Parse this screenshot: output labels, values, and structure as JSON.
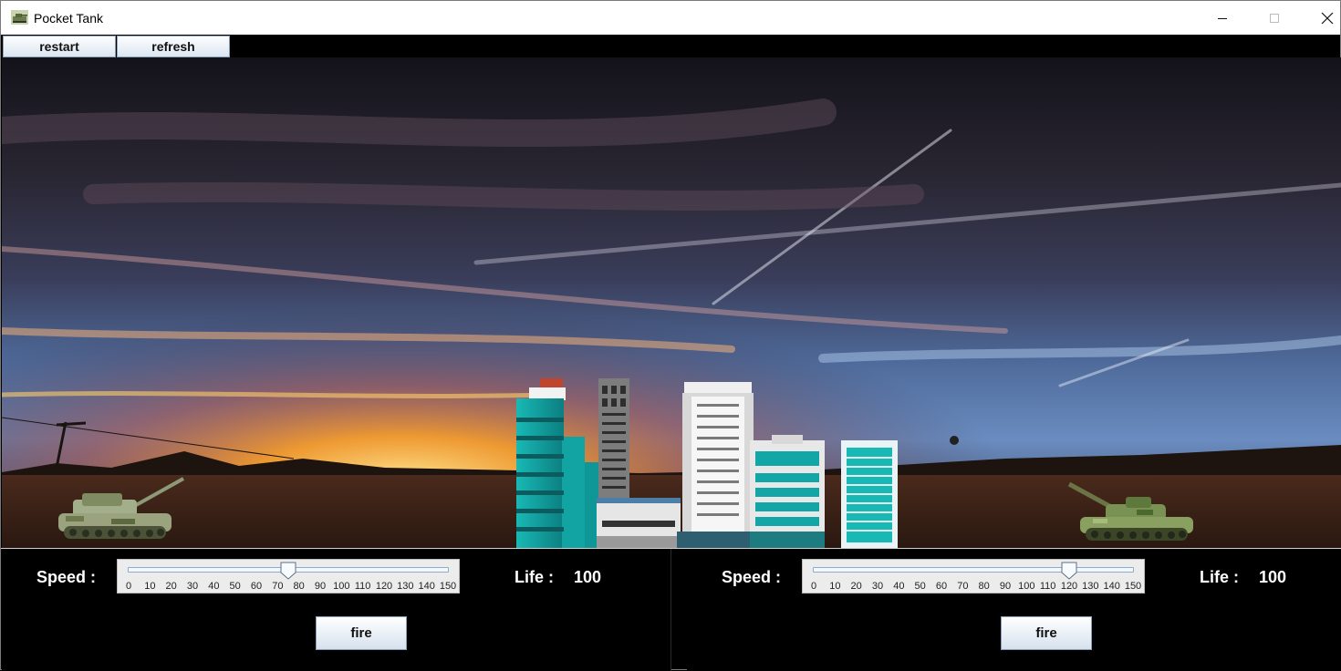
{
  "window": {
    "title": "Pocket Tank",
    "icon": "tank-app-icon",
    "controls": [
      "minimize-icon",
      "maximize-icon",
      "close-icon"
    ]
  },
  "toolbar": {
    "restart_label": "restart",
    "refresh_label": "refresh"
  },
  "players": [
    {
      "speed_label": "Speed :",
      "speed_value": 75,
      "speed_min": 0,
      "speed_max": 150,
      "ticks": [
        "0",
        "10",
        "20",
        "30",
        "40",
        "50",
        "60",
        "70",
        "80",
        "90",
        "100",
        "110",
        "120",
        "130",
        "140",
        "150"
      ],
      "life_label": "Life :",
      "life_value": "100",
      "fire_label": "fire"
    },
    {
      "speed_label": "Speed :",
      "speed_value": 120,
      "speed_min": 0,
      "speed_max": 150,
      "ticks": [
        "0",
        "10",
        "20",
        "30",
        "40",
        "50",
        "60",
        "70",
        "80",
        "90",
        "100",
        "110",
        "120",
        "130",
        "140",
        "150"
      ],
      "life_label": "Life :",
      "life_value": "100",
      "fire_label": "fire"
    }
  ],
  "colors": {
    "sky_dark": "#1c1a24",
    "sunset": "#f59a2a",
    "sky_blue": "#4f7fc0",
    "ground": "#3a2418",
    "building_teal": "#12a7a6",
    "tank_camo": "#8a9c6a"
  }
}
